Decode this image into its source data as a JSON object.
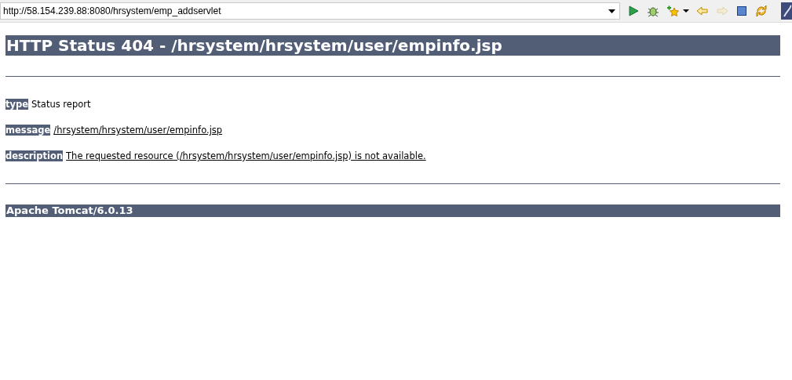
{
  "address_bar": {
    "url": "http://58.154.239.88:8080/hrsystem/emp_addservlet"
  },
  "toolbar": [
    {
      "kind": "run",
      "disabled": false
    },
    {
      "kind": "debug",
      "disabled": false
    },
    {
      "kind": "bookmark",
      "disabled": false
    },
    {
      "kind": "menu",
      "disabled": false
    },
    {
      "kind": "back",
      "disabled": false
    },
    {
      "kind": "forward",
      "disabled": true
    },
    {
      "kind": "stop",
      "disabled": false
    },
    {
      "kind": "refresh",
      "disabled": false
    },
    {
      "kind": "perspective",
      "disabled": false
    }
  ],
  "page": {
    "heading": "HTTP Status 404 - /hrsystem/hrsystem/user/empinfo.jsp",
    "fields": [
      {
        "label": "type",
        "value": "Status report",
        "underlined": false
      },
      {
        "label": "message",
        "value": "/hrsystem/hrsystem/user/empinfo.jsp",
        "underlined": true
      },
      {
        "label": "description",
        "value": "The requested resource (/hrsystem/hrsystem/user/empinfo.jsp) is not available.",
        "underlined": true
      }
    ],
    "footer": "Apache Tomcat/6.0.13"
  }
}
